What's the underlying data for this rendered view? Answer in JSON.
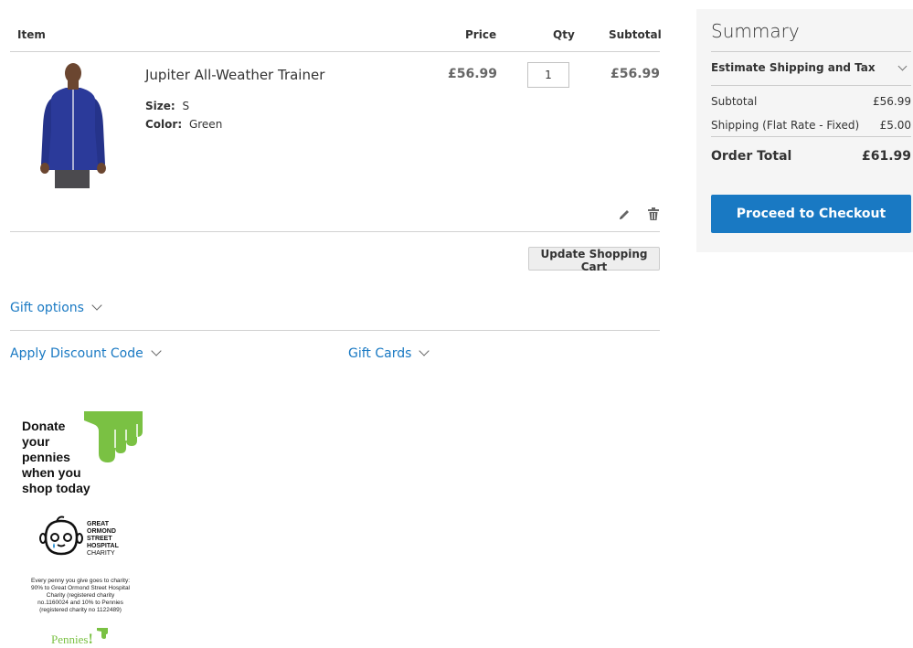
{
  "table": {
    "headers": {
      "item": "Item",
      "price": "Price",
      "qty": "Qty",
      "subtotal": "Subtotal"
    },
    "rows": [
      {
        "name": "Jupiter All-Weather Trainer",
        "options": [
          {
            "label": "Size:",
            "value": "S"
          },
          {
            "label": "Color:",
            "value": "Green"
          }
        ],
        "price": "£56.99",
        "qty": "1",
        "subtotal": "£56.99"
      }
    ]
  },
  "actions": {
    "update_cart": "Update Shopping Cart"
  },
  "gift_options": "Gift options",
  "discount": "Apply Discount Code",
  "gift_cards": "Gift Cards",
  "summary": {
    "title": "Summary",
    "estimate": "Estimate Shipping and Tax",
    "subtotal_label": "Subtotal",
    "subtotal_value": "£56.99",
    "shipping_label": "Shipping (Flat Rate - Fixed)",
    "shipping_value": "£5.00",
    "total_label": "Order Total",
    "total_value": "£61.99",
    "checkout": "Proceed to Checkout"
  },
  "promo": {
    "line1": "Donate",
    "line2": "your",
    "line3": "pennies",
    "line4": "when you",
    "line5": "shop today",
    "charity1": "GREAT",
    "charity2": "ORMOND",
    "charity3": "STREET",
    "charity4": "HOSPITAL",
    "charity5": "CHARITY",
    "fine1": "Every penny you give goes to charity:",
    "fine2": "90% to Great Ormond Street Hospital",
    "fine3": "Charity (registered charity",
    "fine4": "no.1160024 and 10% to Pennies",
    "fine5": "(registered charity no 1122489)",
    "brand": "Pennies",
    "brand_mark": "!"
  },
  "colors": {
    "link": "#1979c3",
    "checkout": "#1979c3",
    "promo_green": "#7ac143"
  }
}
